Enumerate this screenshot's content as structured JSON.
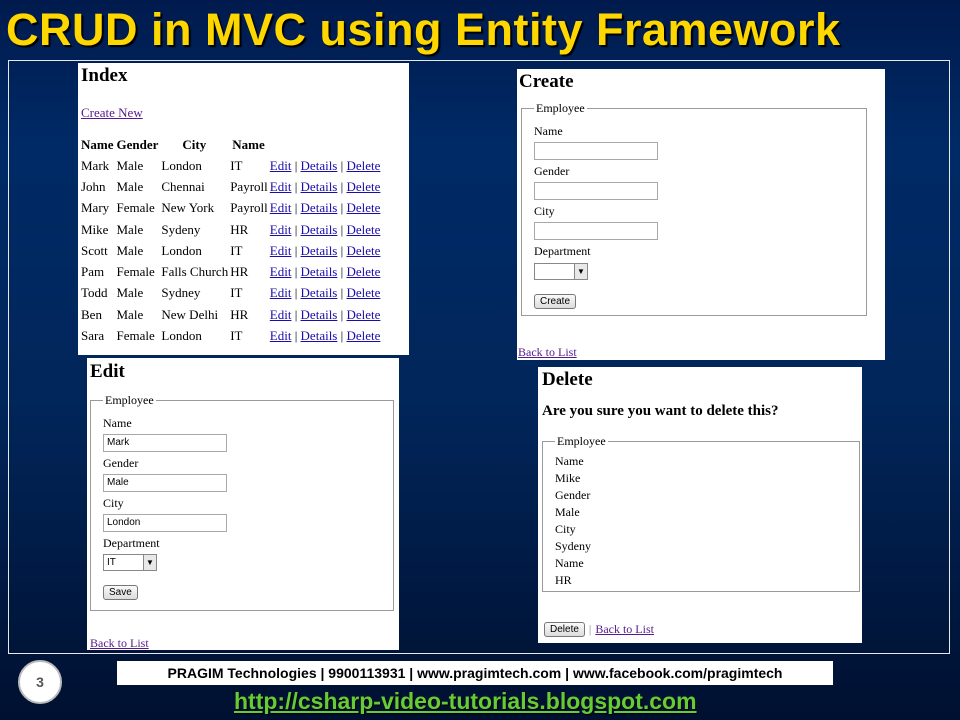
{
  "slide": {
    "title": "CRUD in MVC using Entity Framework",
    "page_number": "3",
    "footer": "PRAGIM Technologies | 9900113931 | www.pragimtech.com | www.facebook.com/pragimtech",
    "url": "http://csharp-video-tutorials.blogspot.com"
  },
  "index": {
    "title": "Index",
    "create_new": "Create New",
    "columns": [
      "Name",
      "Gender",
      "City",
      "Name"
    ],
    "rows": [
      {
        "name": "Mark",
        "gender": "Male",
        "city": "London",
        "dept": "IT"
      },
      {
        "name": "John",
        "gender": "Male",
        "city": "Chennai",
        "dept": "Payroll"
      },
      {
        "name": "Mary",
        "gender": "Female",
        "city": "New York",
        "dept": "Payroll"
      },
      {
        "name": "Mike",
        "gender": "Male",
        "city": "Sydeny",
        "dept": "HR"
      },
      {
        "name": "Scott",
        "gender": "Male",
        "city": "London",
        "dept": "IT"
      },
      {
        "name": "Pam",
        "gender": "Female",
        "city": "Falls Church",
        "dept": "HR"
      },
      {
        "name": "Todd",
        "gender": "Male",
        "city": "Sydney",
        "dept": "IT"
      },
      {
        "name": "Ben",
        "gender": "Male",
        "city": "New Delhi",
        "dept": "HR"
      },
      {
        "name": "Sara",
        "gender": "Female",
        "city": "London",
        "dept": "IT"
      }
    ],
    "actions": {
      "edit": "Edit",
      "details": "Details",
      "delete": "Delete",
      "sep": "|"
    }
  },
  "create": {
    "title": "Create",
    "legend": "Employee",
    "labels": {
      "name": "Name",
      "gender": "Gender",
      "city": "City",
      "department": "Department"
    },
    "values": {
      "name": "",
      "gender": "",
      "city": "",
      "department": ""
    },
    "button": "Create",
    "back": "Back to List"
  },
  "edit": {
    "title": "Edit",
    "legend": "Employee",
    "labels": {
      "name": "Name",
      "gender": "Gender",
      "city": "City",
      "department": "Department"
    },
    "values": {
      "name": "Mark",
      "gender": "Male",
      "city": "London",
      "department": "IT"
    },
    "button": "Save",
    "back": "Back to List"
  },
  "delete": {
    "title": "Delete",
    "question": "Are you sure you want to delete this?",
    "legend": "Employee",
    "lines": [
      "Name",
      "Mike",
      "Gender",
      "Male",
      "City",
      "Sydeny",
      "Name",
      "HR"
    ],
    "button": "Delete",
    "sep": "|",
    "back": "Back to List"
  }
}
